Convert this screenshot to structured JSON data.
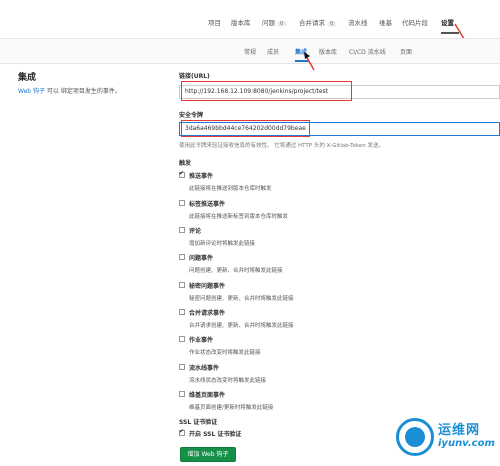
{
  "topnav": {
    "items": [
      {
        "label": "项目"
      },
      {
        "label": "版本库"
      },
      {
        "label": "问题",
        "count": "0"
      },
      {
        "label": "合并请求",
        "count": "0"
      },
      {
        "label": "流水线"
      },
      {
        "label": "维基"
      },
      {
        "label": "代码片段"
      },
      {
        "label": "设置"
      }
    ]
  },
  "subnav": {
    "items": [
      {
        "label": "常规"
      },
      {
        "label": "成员"
      },
      {
        "label": "集成"
      },
      {
        "label": "版本库"
      },
      {
        "label": "CI/CD 流水线"
      },
      {
        "label": "页面"
      }
    ]
  },
  "section": {
    "title": "集成",
    "desc_link": "Web 钩子",
    "desc_rest": " 可以 绑定项目发生的事件。"
  },
  "form": {
    "url_label": "链接(URL)",
    "url_value": "http://192.168.12.109:8080/jenkins/project/test",
    "token_label": "安全令牌",
    "token_value": "3da6a469bbd44ce764202d00dd79beae",
    "token_help": "使用此令牌来验证接收信息的有效性。 它将通过 HTTP 头的 X-Gitlab-Token 发送。",
    "trigger_label": "触发"
  },
  "triggers": [
    {
      "label": "推送事件",
      "desc": "此链接将在推送到版本仓库时触发",
      "checked": true
    },
    {
      "label": "标签推送事件",
      "desc": "此链接将在推送新标签到版本仓库时触发",
      "checked": false
    },
    {
      "label": "评论",
      "desc": "增加新评论时将触发此链接",
      "checked": false
    },
    {
      "label": "问题事件",
      "desc": "问题创建、更新、合并时将触发此链接",
      "checked": false
    },
    {
      "label": "秘密问题事件",
      "desc": "秘密问题创建、更新、合并时将触发此链接",
      "checked": false
    },
    {
      "label": "合并请求事件",
      "desc": "合并请求创建、更新、合并时将触发此链接",
      "checked": false
    },
    {
      "label": "作业事件",
      "desc": "作业状态改变时将触发此链接",
      "checked": false
    },
    {
      "label": "流水线事件",
      "desc": "流水线状态改变时将触发此链接",
      "checked": false
    },
    {
      "label": "维基页面事件",
      "desc": "维基页面创建/更新时将触发此链接",
      "checked": false
    }
  ],
  "ssl": {
    "label": "SSL 证书验证",
    "option": "开启 SSL 证书验证",
    "checked": true
  },
  "submit_label": "增加 Web 钩子",
  "watermark": {
    "line1": "运维网",
    "line2": "iyunv.com"
  },
  "colors": {
    "accent": "#1f78d1",
    "button": "#168f48",
    "highlight_box": "#e53935",
    "watermark": "#1a8fd6"
  }
}
